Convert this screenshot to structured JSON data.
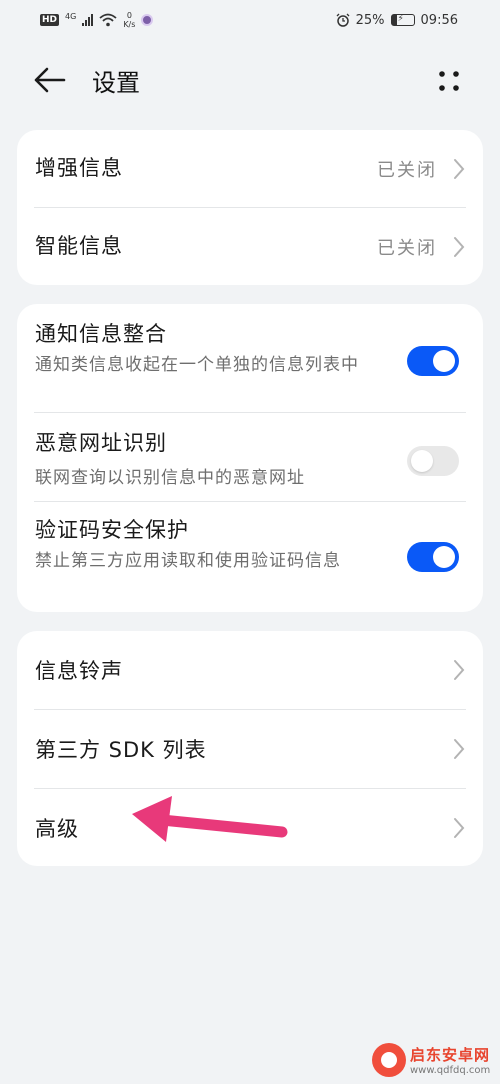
{
  "status_bar": {
    "hd": "HD",
    "signal_label": "4G",
    "net_speed_value": "0",
    "net_speed_unit": "K/s",
    "battery_percent": "25%",
    "time": "09:56"
  },
  "header": {
    "title": "设置"
  },
  "card1": {
    "items": [
      {
        "title": "增强信息",
        "value": "已关闭"
      },
      {
        "title": "智能信息",
        "value": "已关闭"
      }
    ]
  },
  "card2": {
    "items": [
      {
        "title": "通知信息整合",
        "subtitle": "通知类信息收起在一个单独的信息列表中",
        "toggle": true
      },
      {
        "title": "恶意网址识别",
        "subtitle": "联网查询以识别信息中的恶意网址",
        "toggle": false
      },
      {
        "title": "验证码安全保护",
        "subtitle": "禁止第三方应用读取和使用验证码信息",
        "toggle": true
      }
    ]
  },
  "card3": {
    "items": [
      {
        "title": "信息铃声"
      },
      {
        "title": "第三方 SDK 列表"
      },
      {
        "title": "高级"
      }
    ]
  },
  "watermark": {
    "name": "启东安卓网",
    "url": "www.qdfdq.com"
  },
  "colors": {
    "accent": "#0a59f7",
    "background": "#f1f3f5",
    "annotation_arrow": "#e8397a"
  }
}
